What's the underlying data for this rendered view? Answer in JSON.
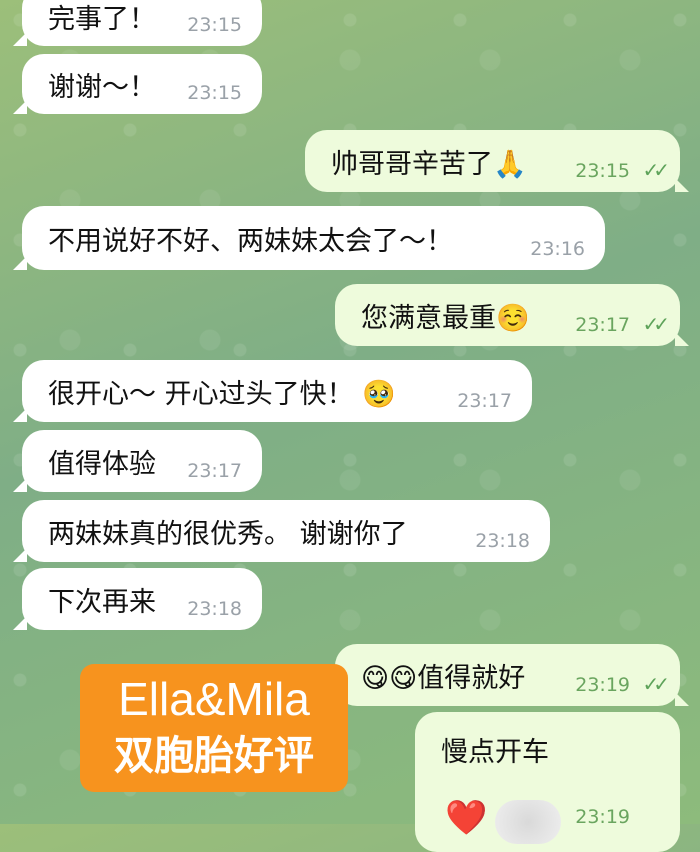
{
  "messages": [
    {
      "dir": "in",
      "text": "完事了！",
      "time": "23:15"
    },
    {
      "dir": "in",
      "text": "谢谢～！",
      "time": "23:15"
    },
    {
      "dir": "out",
      "text": "帅哥哥辛苦了🙏",
      "time": "23:15",
      "status": "✓✓"
    },
    {
      "dir": "in",
      "text": "不用说好不好、两妹妹太会了～！",
      "time": "23:16"
    },
    {
      "dir": "out",
      "text": "您满意最重☺️",
      "time": "23:17",
      "status": "✓✓"
    },
    {
      "dir": "in",
      "text": "很开心～ 开心过头了快！ 🥹",
      "time": "23:17"
    },
    {
      "dir": "in",
      "text": "值得体验",
      "time": "23:17"
    },
    {
      "dir": "in",
      "text": "两妹妹真的很优秀。 谢谢你了",
      "time": "23:18"
    },
    {
      "dir": "in",
      "text": "下次再来",
      "time": "23:18"
    },
    {
      "dir": "out",
      "text": "😋😋值得就好",
      "time": "23:19",
      "status": "✓✓"
    },
    {
      "dir": "out",
      "text": "慢点开车",
      "time": "23:19",
      "reaction": "❤️"
    }
  ],
  "overlay": {
    "line1": "Ella&Mila",
    "line2": "双胞胎好评"
  },
  "colors": {
    "incoming": "#ffffff",
    "outgoing": "#eefbdc",
    "tick": "#5ea35a",
    "sticker": "#f7931e"
  }
}
